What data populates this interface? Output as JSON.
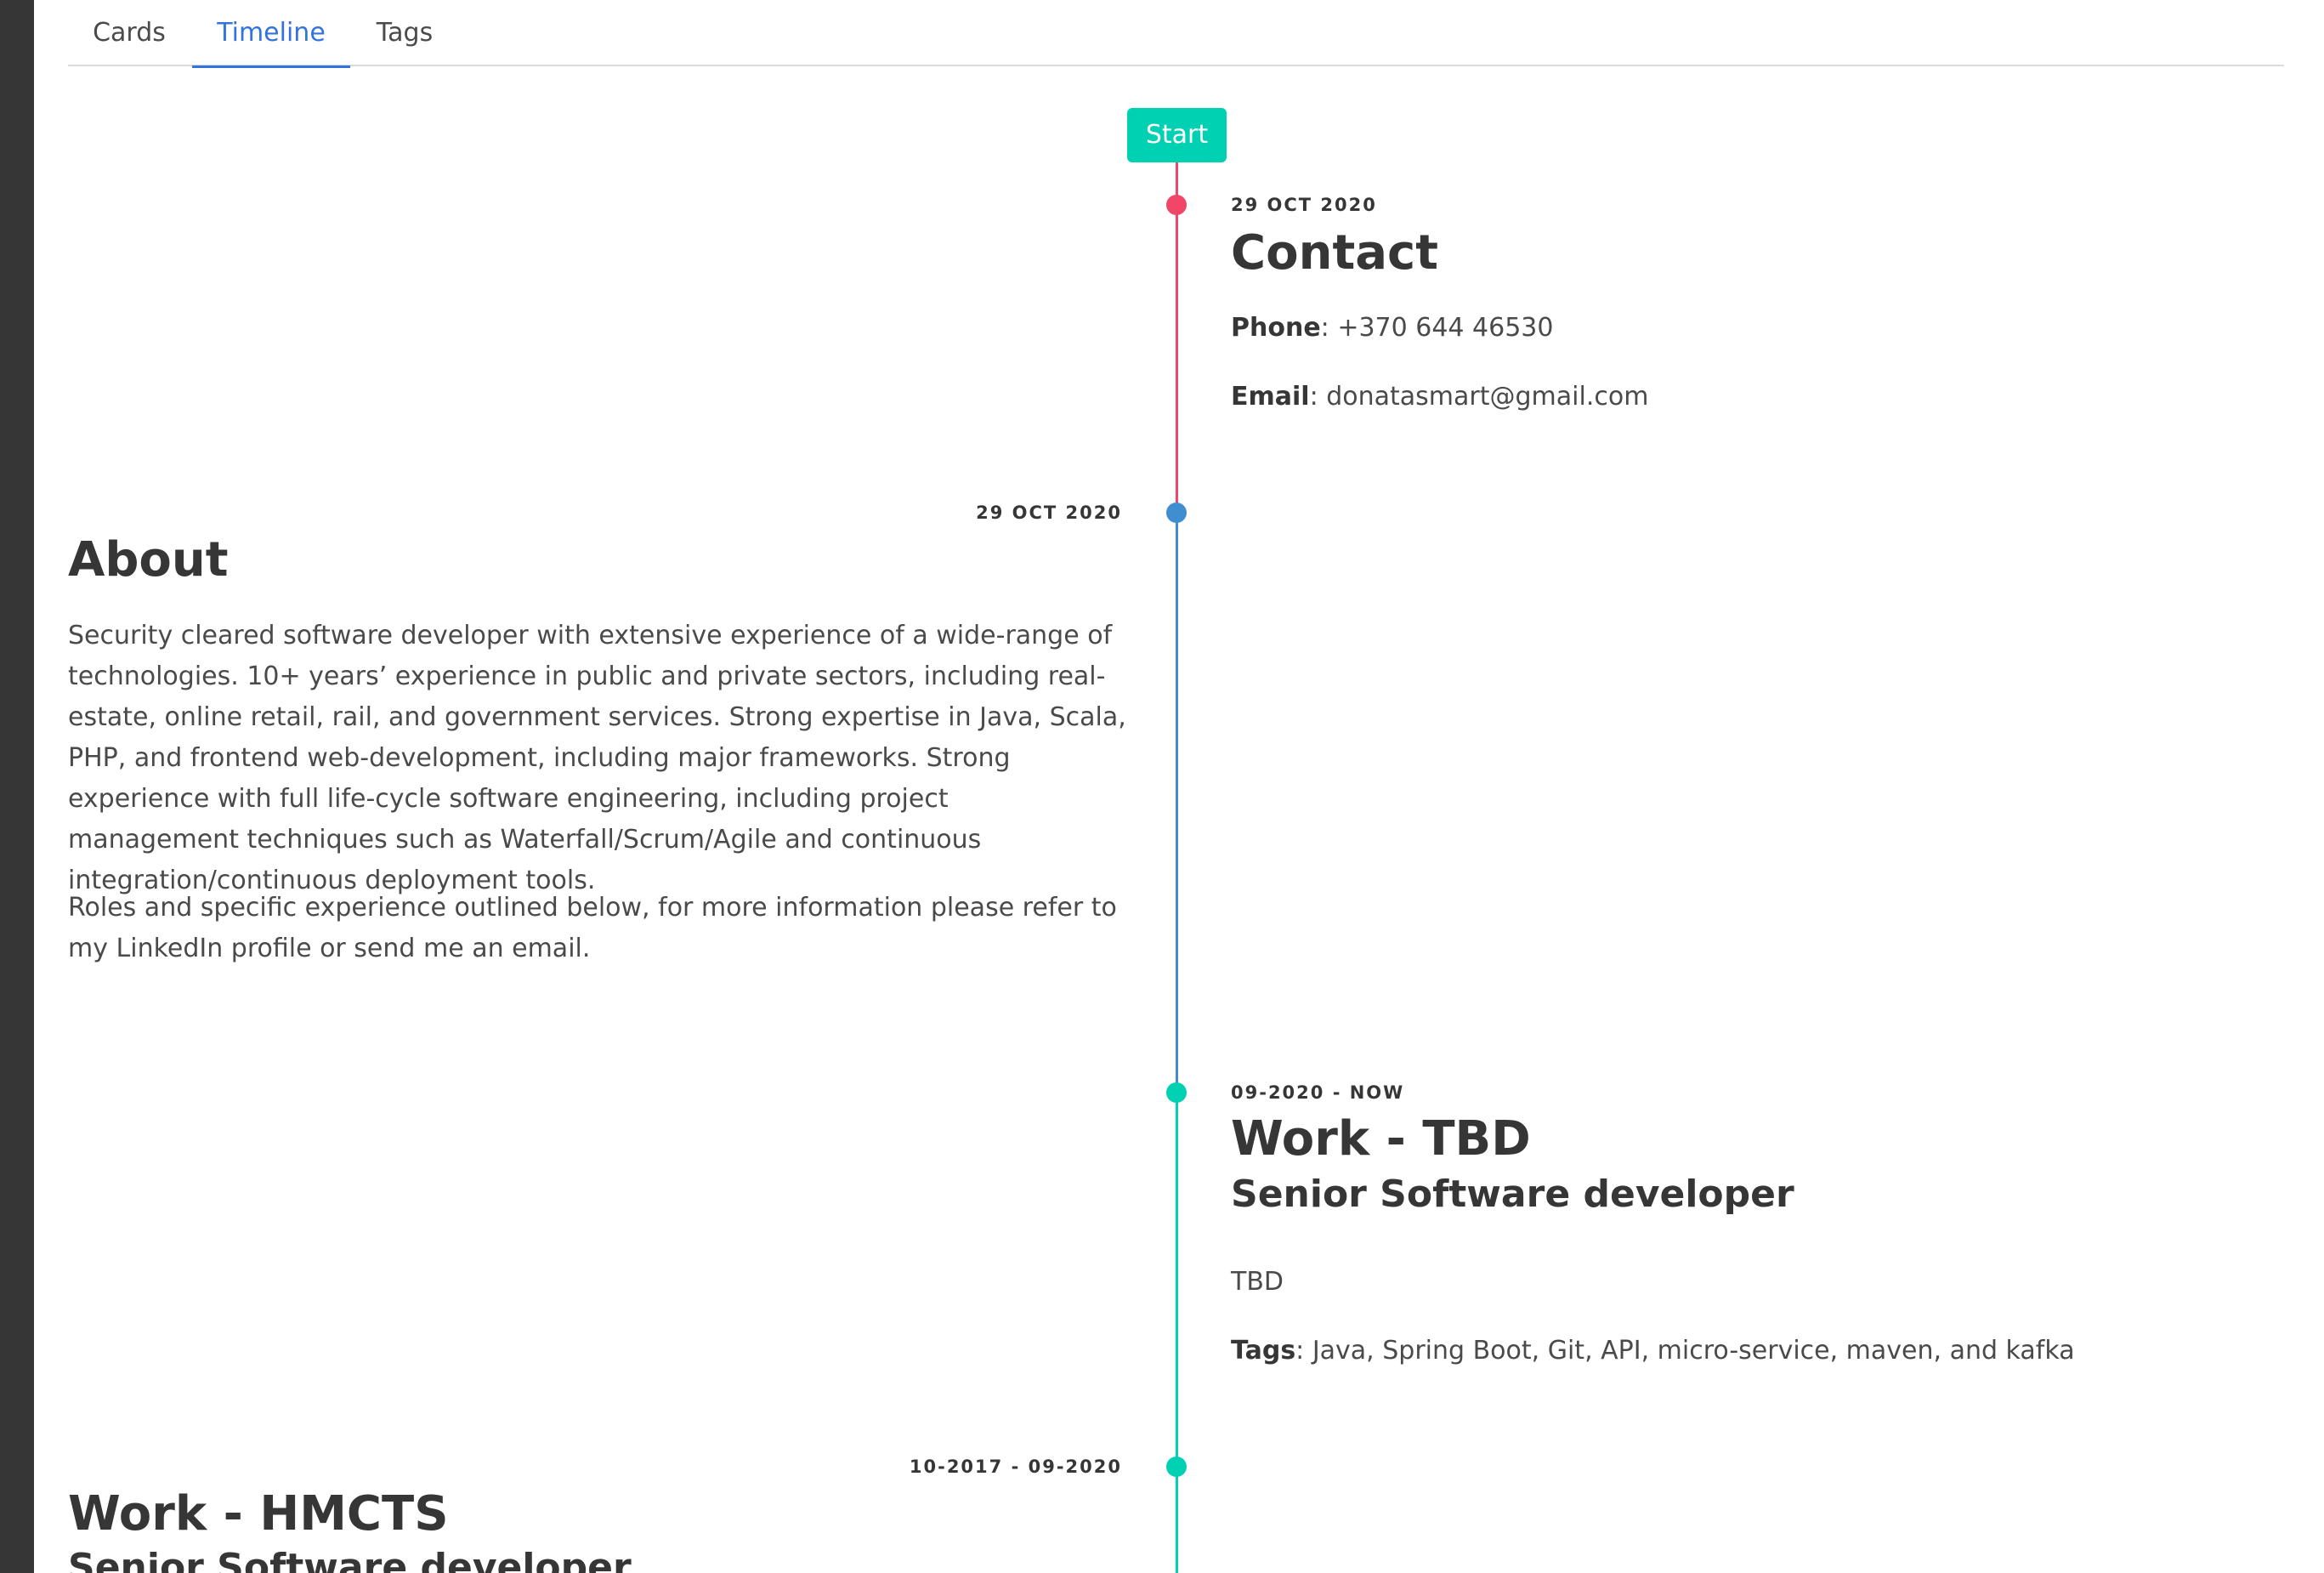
{
  "tabs": [
    {
      "label": "Cards"
    },
    {
      "label": "Timeline"
    },
    {
      "label": "Tags"
    }
  ],
  "timeline": {
    "start_label": "Start",
    "colors": {
      "red": "#f14668",
      "blue": "#3e8ed0",
      "teal": "#00d1b2"
    },
    "contact": {
      "date": "29 OCT 2020",
      "title": "Contact",
      "phone_label": "Phone",
      "phone": ": +370 644 46530",
      "email_label": "Email",
      "email": ": donatasmart@gmail.com"
    },
    "about": {
      "date": "29 OCT 2020",
      "title": "About",
      "p1": "Security cleared software developer with extensive experience of a wide-range of technologies. 10+ years’ experience in public and private sectors, including real-estate, online retail, rail, and government services. Strong expertise in Java, Scala, PHP, and frontend web-development, including major frameworks. Strong experience with full life-cycle software engineering, including project management techniques such as Waterfall/Scrum/Agile and continuous integration/continuous deployment tools.",
      "p2": "Roles and specific experience outlined below, for more information please refer to my LinkedIn profile or send me an email."
    },
    "work_tbd": {
      "date": "09-2020 - NOW",
      "title": "Work - TBD",
      "subtitle": "Senior Software developer",
      "description": "TBD",
      "tags_label": "Tags",
      "tags": ": Java, Spring Boot, Git, API, micro-service, maven, and kafka"
    },
    "work_hmcts": {
      "date": "10-2017 - 09-2020",
      "title": "Work - HMCTS",
      "subtitle": "Senior Software developer"
    }
  }
}
